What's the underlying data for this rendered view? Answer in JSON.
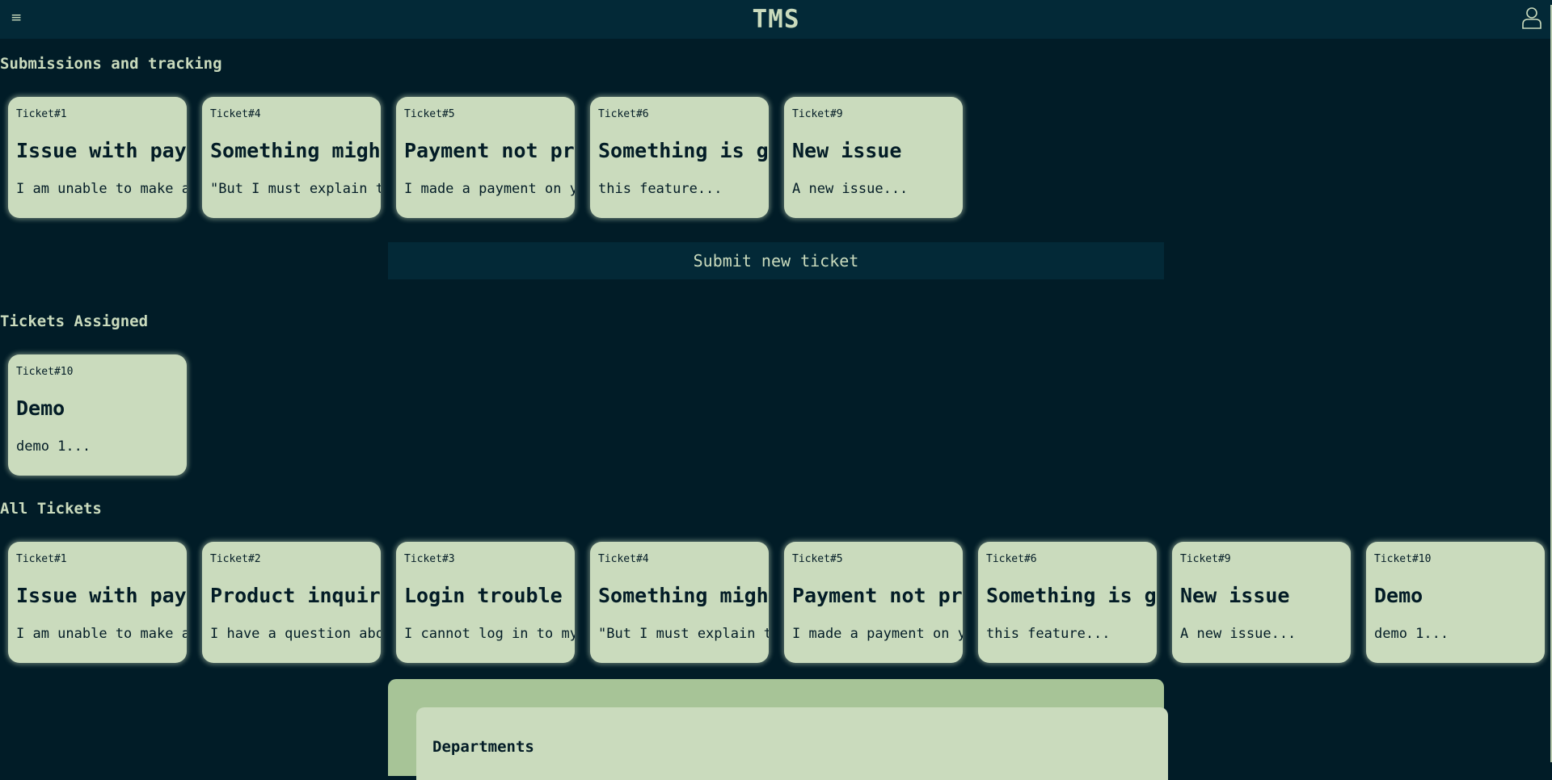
{
  "header": {
    "menu_glyph": "≡",
    "title": "TMS",
    "user_icon": "user-icon"
  },
  "sections": {
    "submissions": {
      "title": "Submissions and tracking",
      "cards": [
        {
          "id": "Ticket#1",
          "title": "Issue with paym",
          "desc": "I am unable to make a"
        },
        {
          "id": "Ticket#4",
          "title": "Something might",
          "desc": "\"But I must explain to"
        },
        {
          "id": "Ticket#5",
          "title": "Payment not pro",
          "desc": "I made a payment on yo"
        },
        {
          "id": "Ticket#6",
          "title": "Something is gi",
          "desc": "this feature..."
        },
        {
          "id": "Ticket#9",
          "title": "New issue",
          "desc": "A new issue..."
        }
      ]
    },
    "submit_button": "Submit new ticket",
    "assigned": {
      "title": "Tickets Assigned",
      "cards": [
        {
          "id": "Ticket#10",
          "title": "Demo",
          "desc": "demo 1..."
        }
      ]
    },
    "all": {
      "title": "All Tickets",
      "cards": [
        {
          "id": "Ticket#1",
          "title": "Issue with paym",
          "desc": "I am unable to make a"
        },
        {
          "id": "Ticket#2",
          "title": "Product inquiry",
          "desc": "I have a question abou"
        },
        {
          "id": "Ticket#3",
          "title": "Login trouble",
          "desc": "I cannot log in to my"
        },
        {
          "id": "Ticket#4",
          "title": "Something might",
          "desc": "\"But I must explain to"
        },
        {
          "id": "Ticket#5",
          "title": "Payment not pro",
          "desc": "I made a payment on yo"
        },
        {
          "id": "Ticket#6",
          "title": "Something is gi",
          "desc": "this feature..."
        },
        {
          "id": "Ticket#9",
          "title": "New issue",
          "desc": "A new issue..."
        },
        {
          "id": "Ticket#10",
          "title": "Demo",
          "desc": "demo 1..."
        }
      ]
    },
    "departments": {
      "title": "Departments"
    }
  },
  "colors": {
    "background": "#011c27",
    "header": "#032937",
    "card": "#cadbbd",
    "panel": "#a7c497",
    "text_dark": "#031c26"
  }
}
